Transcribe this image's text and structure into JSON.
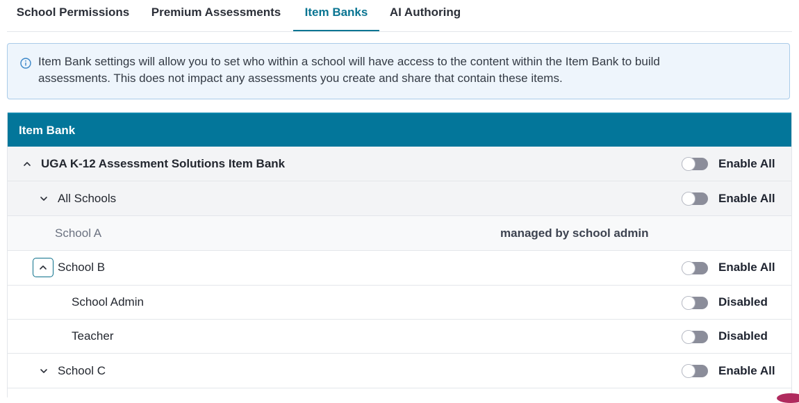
{
  "tabs": [
    {
      "label": "School Permissions",
      "active": false
    },
    {
      "label": "Premium Assessments",
      "active": false
    },
    {
      "label": "Item Banks",
      "active": true
    },
    {
      "label": "AI Authoring",
      "active": false
    }
  ],
  "info": {
    "icon": "info-circle-icon",
    "text": "Item Bank settings will allow you to set who within a school will have access to the content within the Item Bank to build assessments. This does not impact any assessments you create and share that contain these items."
  },
  "table": {
    "header": "Item Bank",
    "rows": [
      {
        "label": "UGA K-12 Assessment Solutions Item Bank",
        "expanded": true,
        "toggle_label": "Enable All",
        "enabled": false
      },
      {
        "label": "All Schools",
        "expanded": false,
        "toggle_label": "Enable All",
        "enabled": false
      },
      {
        "label": "School A",
        "managed": "managed by school admin"
      },
      {
        "label": "School B",
        "expanded": true,
        "toggle_label": "Enable All",
        "enabled": false
      },
      {
        "label": "School Admin",
        "toggle_label": "Disabled",
        "enabled": false
      },
      {
        "label": "Teacher",
        "toggle_label": "Disabled",
        "enabled": false
      },
      {
        "label": "School C",
        "expanded": false,
        "toggle_label": "Enable All",
        "enabled": false
      }
    ]
  },
  "colors": {
    "accent": "#0a7592",
    "header_bg": "#03769a",
    "info_bg": "#eef5fc",
    "info_border": "#a9cbe9",
    "toggle_off": "#8b8d9a"
  }
}
